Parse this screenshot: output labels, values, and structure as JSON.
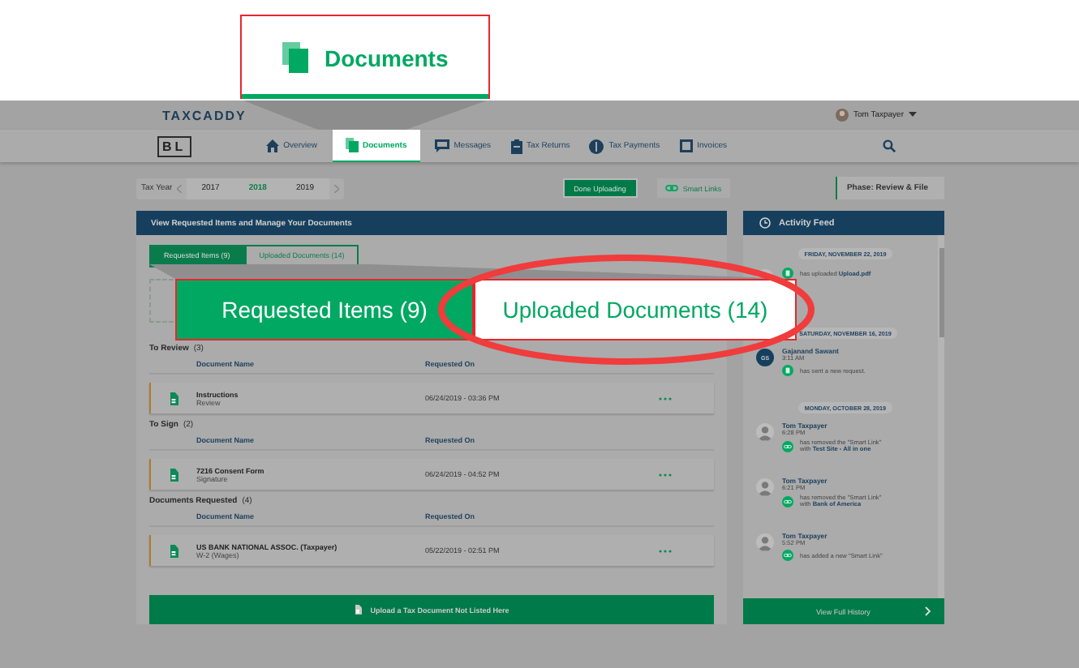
{
  "callout_nav": {
    "label": "Documents"
  },
  "header": {
    "logo": "TAXCADDY",
    "user": "Tom Taxpayer"
  },
  "client_badge": "BL",
  "nav": [
    {
      "label": "Overview",
      "selected": false
    },
    {
      "label": "Documents",
      "selected": true
    },
    {
      "label": "Messages",
      "selected": false
    },
    {
      "label": "Tax Returns",
      "selected": false
    },
    {
      "label": "Tax Payments",
      "selected": false
    },
    {
      "label": "Invoices",
      "selected": false
    }
  ],
  "tax_year": {
    "label": "Tax Year",
    "years": [
      {
        "label": "2017",
        "selected": false
      },
      {
        "label": "2018",
        "selected": true
      },
      {
        "label": "2019",
        "selected": false
      }
    ]
  },
  "actions": [
    {
      "label": "Done Uploading",
      "kind": "primary"
    },
    {
      "label": "Smart Links",
      "kind": "link"
    }
  ],
  "phase": "Phase: Review & File",
  "documents_panel": {
    "title": "View Requested Items and Manage Your Documents",
    "tabs": [
      {
        "label": "Requested Items (9)",
        "selected": true
      },
      {
        "label": "Uploaded Documents (14)",
        "selected": false
      }
    ],
    "sections": [
      {
        "title": "To Review",
        "count": "(3)",
        "columns": [
          "Document Name",
          "Requested On"
        ],
        "rows": [
          {
            "name": "Instructions",
            "type": "Review",
            "requested_on": "06/24/2019 - 03:36 PM"
          }
        ]
      },
      {
        "title": "To Sign",
        "count": "(2)",
        "columns": [
          "Document Name",
          "Requested On"
        ],
        "rows": [
          {
            "name": "7216 Consent Form",
            "type": "Signature",
            "requested_on": "06/24/2019 - 04:52 PM"
          }
        ]
      },
      {
        "title": "Documents Requested",
        "count": "(4)",
        "columns": [
          "Document Name",
          "Requested On"
        ],
        "rows": [
          {
            "name": "US BANK NATIONAL ASSOC. (Taxpayer)",
            "type": "W-2 (Wages)",
            "requested_on": "05/22/2019 - 02:51 PM"
          }
        ]
      }
    ],
    "upload_button": "Upload a Tax Document Not Listed Here"
  },
  "callout_tabs": [
    {
      "label": "Requested Items (9)",
      "selected": true,
      "circled": false
    },
    {
      "label": "Uploaded Documents (14)",
      "selected": false,
      "circled": true
    }
  ],
  "activity_feed": {
    "title": "Activity Feed",
    "groups": [
      {
        "date": "FRIDAY, NOVEMBER 22, 2019",
        "entries": [
          {
            "kind": "document",
            "text": "has uploaded **Upload.pdf**"
          }
        ]
      },
      {
        "date": "SATURDAY, NOVEMBER 16, 2019",
        "entries": [
          {
            "kind": "document",
            "initials": "GS",
            "name": "Gajanand Sawant",
            "time": "3:11 AM",
            "text": "has sent a new request."
          }
        ]
      },
      {
        "date": "MONDAY, OCTOBER 28, 2019",
        "entries": [
          {
            "kind": "link",
            "name": "Tom Taxpayer",
            "time": "6:28 PM",
            "text": "has removed the \"Smart Link\" with **Test Site - All in one**"
          },
          {
            "kind": "link",
            "name": "Tom Taxpayer",
            "time": "6:21 PM",
            "text": "has removed the \"Smart Link\" with **Bank of America**"
          },
          {
            "kind": "link",
            "name": "Tom Taxpayer",
            "time": "5:52 PM",
            "text": "has added a new \"Smart Link\""
          }
        ]
      }
    ],
    "footer": "View Full History"
  }
}
